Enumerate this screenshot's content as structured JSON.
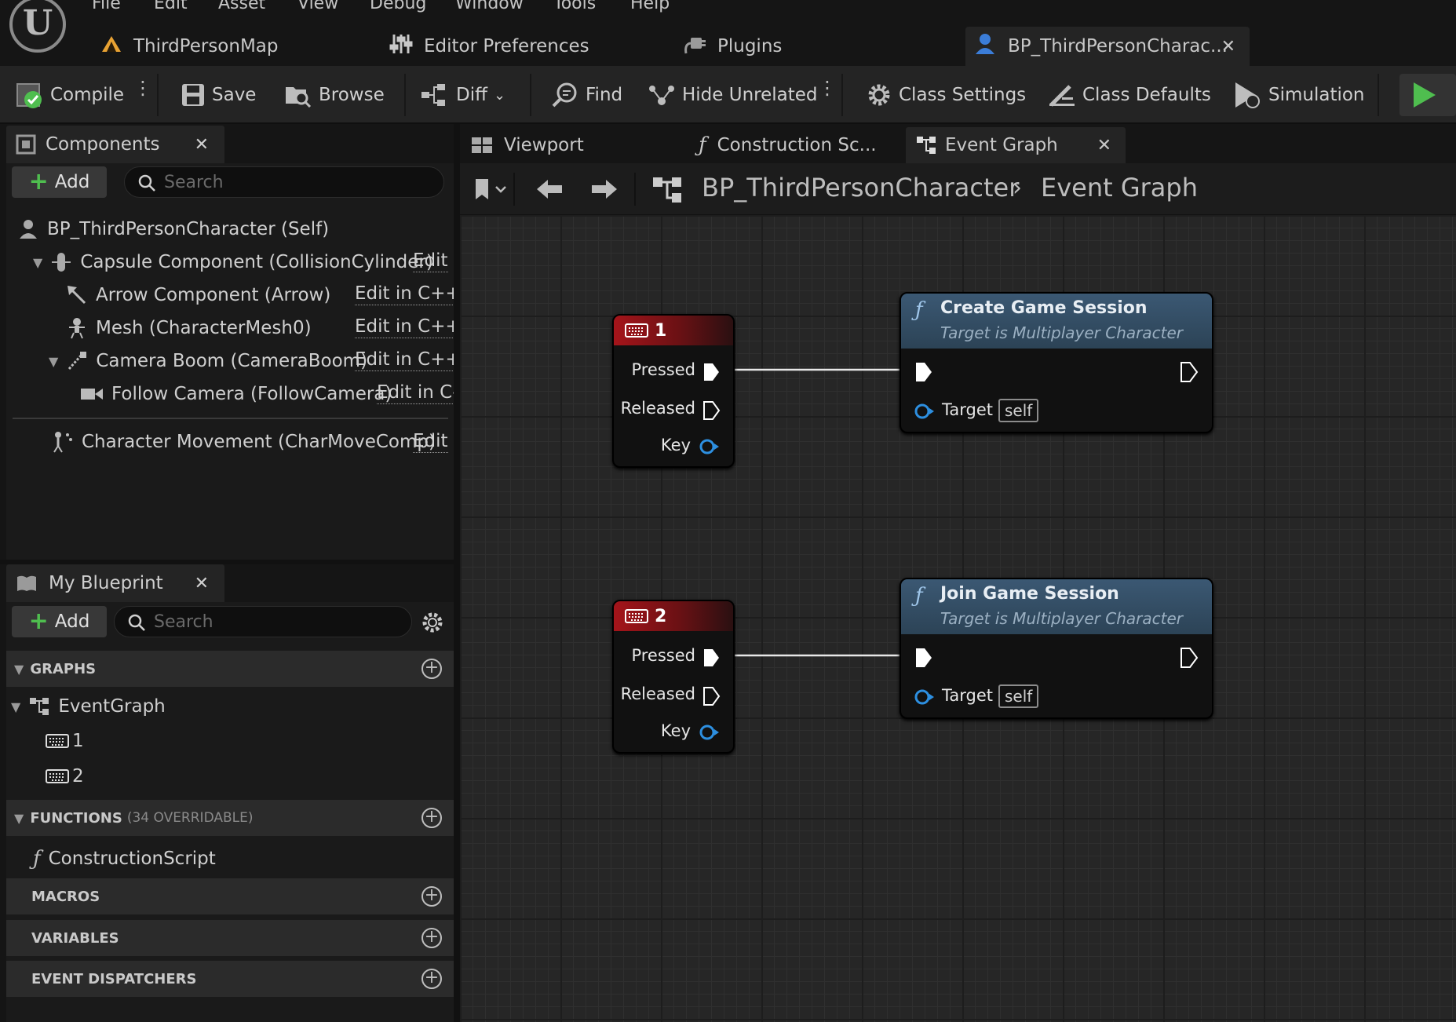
{
  "menu": [
    "File",
    "Edit",
    "Asset",
    "View",
    "Debug",
    "Window",
    "Tools",
    "Help"
  ],
  "doc_tabs": [
    {
      "label": "ThirdPersonMap",
      "icon": "level-icon"
    },
    {
      "label": "Editor Preferences",
      "icon": "sliders-icon"
    },
    {
      "label": "Plugins",
      "icon": "plug-icon"
    },
    {
      "label": "BP_ThirdPersonCharac...",
      "icon": "character-icon",
      "active": true
    }
  ],
  "toolbar": {
    "compile": "Compile",
    "save": "Save",
    "browse": "Browse",
    "diff": "Diff",
    "find": "Find",
    "hide_unrelated": "Hide Unrelated",
    "class_settings": "Class Settings",
    "class_defaults": "Class Defaults",
    "simulation": "Simulation"
  },
  "components": {
    "tab": "Components",
    "add": "Add",
    "search_placeholder": "Search",
    "items": [
      {
        "label": "BP_ThirdPersonCharacter (Self)"
      },
      {
        "label": "Capsule Component (CollisionCylinder)",
        "edit": "Edit"
      },
      {
        "label": "Arrow Component (Arrow)",
        "edit": "Edit in C++"
      },
      {
        "label": "Mesh (CharacterMesh0)",
        "edit": "Edit in C++"
      },
      {
        "label": "Camera Boom (CameraBoom)",
        "edit": "Edit in C++"
      },
      {
        "label": "Follow Camera (FollowCamera)",
        "edit": "Edit in C-"
      },
      {
        "label": "Character Movement (CharMoveComp)",
        "edit": "Edit"
      }
    ]
  },
  "my_blueprint": {
    "tab": "My Blueprint",
    "add": "Add",
    "search_placeholder": "Search",
    "graphs_label": "GRAPHS",
    "event_graph": "EventGraph",
    "events": [
      "1",
      "2"
    ],
    "functions_label": "FUNCTIONS",
    "functions_count": "(34 OVERRIDABLE)",
    "construction_script": "ConstructionScript",
    "macros_label": "MACROS",
    "variables_label": "VARIABLES",
    "dispatchers_label": "EVENT DISPATCHERS"
  },
  "graph_tabs": [
    "Viewport",
    "Construction Sc...",
    "Event Graph"
  ],
  "breadcrumb": {
    "root": "BP_ThirdPersonCharacter",
    "current": "Event Graph"
  },
  "nodes": {
    "key1": {
      "title": "1",
      "pressed": "Pressed",
      "released": "Released",
      "key": "Key"
    },
    "key2": {
      "title": "2",
      "pressed": "Pressed",
      "released": "Released",
      "key": "Key"
    },
    "create": {
      "title": "Create Game Session",
      "subtitle": "Target is Multiplayer Character",
      "target": "Target",
      "self": "self"
    },
    "join": {
      "title": "Join Game Session",
      "subtitle": "Target is Multiplayer Character",
      "target": "Target",
      "self": "self"
    }
  },
  "colors": {
    "accent": "#4fbe4f",
    "key_header": "#a5141a",
    "function_header": "#3b5873",
    "object_pin": "#2d8fe0"
  }
}
